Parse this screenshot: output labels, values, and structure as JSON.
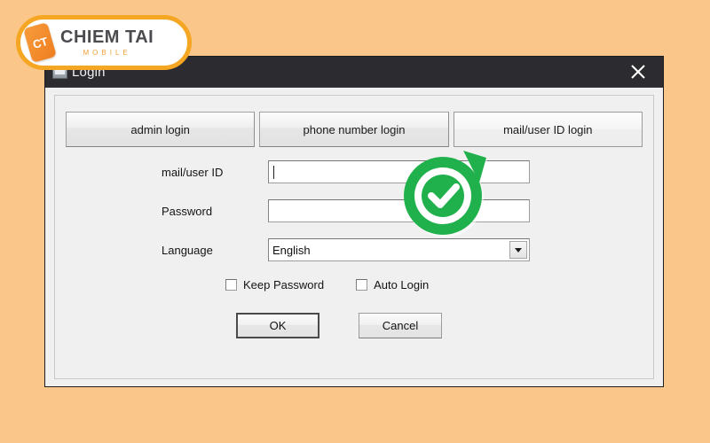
{
  "page": {
    "background_color": "#fac68a"
  },
  "brand": {
    "icon": "phone-icon",
    "monogram": "CT",
    "name": "CHIEM TAI",
    "subtitle": "MOBILE",
    "border_color": "#f5a623",
    "accent_color": "#ef7e20",
    "text_color": "#4b4b4f"
  },
  "window": {
    "title": "Login",
    "icon": "app-window-icon",
    "close_label": "×",
    "titlebar_color": "#2b2b30",
    "body_color": "#f0f0f0"
  },
  "tabs": [
    {
      "label": "admin login",
      "active": false
    },
    {
      "label": "phone number login",
      "active": false
    },
    {
      "label": "mail/user ID login",
      "active": true
    }
  ],
  "form": {
    "fields": [
      {
        "label": "mail/user ID",
        "type": "text",
        "value": "",
        "placeholder": "",
        "focused": true
      },
      {
        "label": "Password",
        "type": "password",
        "value": "",
        "placeholder": "",
        "focused": false
      }
    ],
    "language": {
      "label": "Language",
      "selected": "English",
      "options": [
        "English"
      ],
      "arrow_icon": "chevron-down-icon"
    }
  },
  "checkboxes": [
    {
      "label": "Keep Password",
      "checked": false
    },
    {
      "label": "Auto Login",
      "checked": false
    }
  ],
  "buttons": {
    "ok": "OK",
    "cancel": "Cancel"
  },
  "overlay": {
    "badge": "green-check-badge",
    "color": "#21b14c",
    "ring_color": "#ffffff"
  }
}
